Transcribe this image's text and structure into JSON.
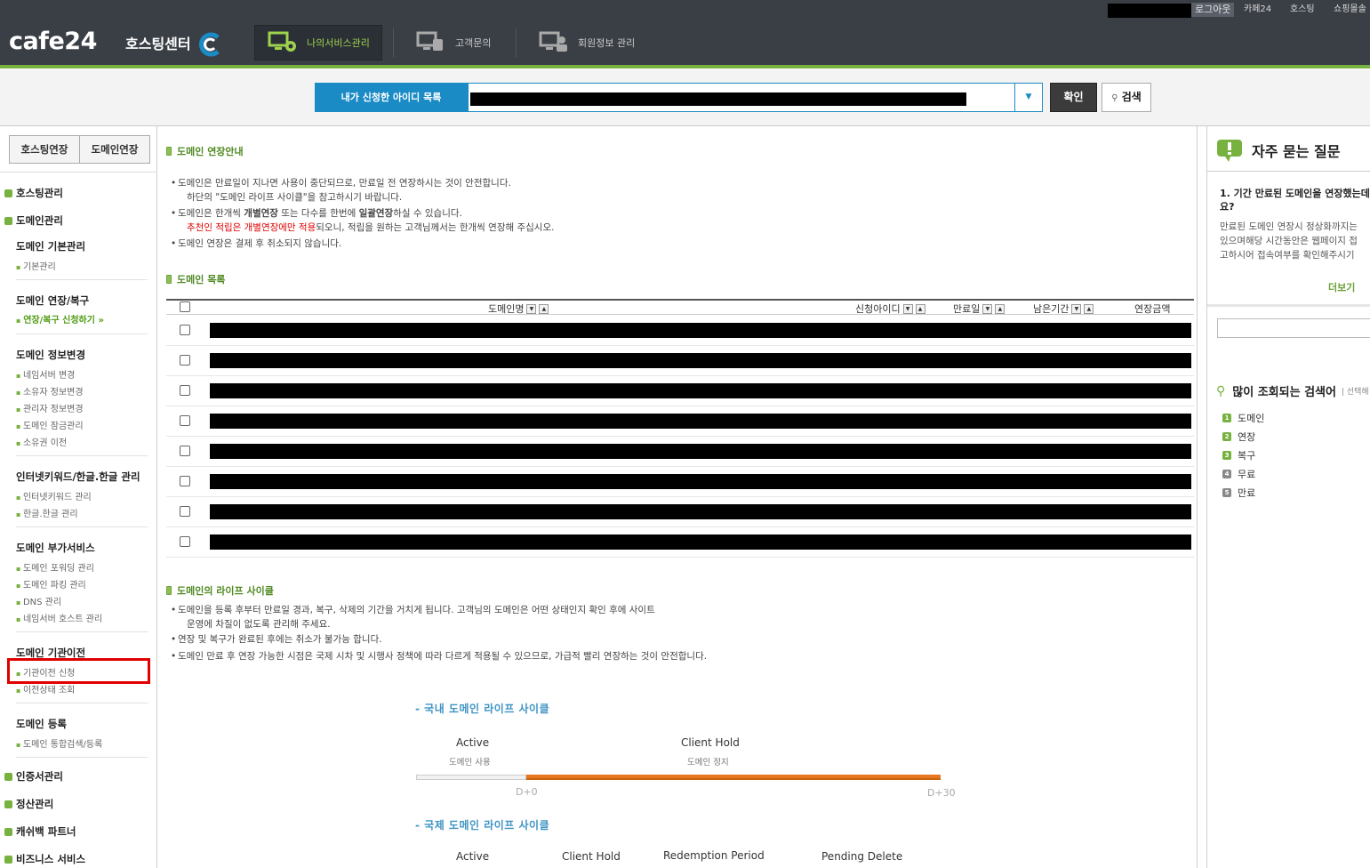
{
  "topbar": {
    "logout": "로그아웃",
    "links": [
      "카페24",
      "호스팅",
      "쇼핑몰솔"
    ]
  },
  "header": {
    "logo": "cafe24",
    "logo_sub": "호스팅센터",
    "nav": [
      {
        "label": "나의서비스관리",
        "active": true
      },
      {
        "label": "고객문의",
        "active": false
      },
      {
        "label": "회원정보 관리",
        "active": false
      }
    ]
  },
  "search": {
    "id_label": "내가 신청한 아이디 목록",
    "ok": "확인",
    "search": "검색"
  },
  "sidebar": {
    "tab_hosting": "호스팅연장",
    "tab_domain": "도메인연장",
    "cat_hosting": "호스팅관리",
    "cat_domain": "도메인관리",
    "groups": [
      {
        "title": "도메인 기본관리",
        "items": [
          "기본관리"
        ]
      },
      {
        "title": "도메인 연장/복구",
        "items": [
          "연장/복구 신청하기"
        ]
      },
      {
        "title": "도메인 정보변경",
        "items": [
          "네임서버 변경",
          "소유자 정보변경",
          "관리자 정보변경",
          "도메인 잠금관리",
          "소유권 이전"
        ]
      },
      {
        "title": "인터넷키워드/한글.한글 관리",
        "items": [
          "인터넷키워드 관리",
          "한글.한글 관리"
        ]
      },
      {
        "title": "도메인 부가서비스",
        "items": [
          "도메인 포워딩 관리",
          "도메인 파킹 관리",
          "DNS 관리",
          "네임서버 호스트 관리"
        ]
      },
      {
        "title": "도메인 기관이전",
        "items": [
          "기관이전 신청",
          "이전상태 조회"
        ]
      },
      {
        "title": "도메인 등록",
        "items": [
          "도메인 통합검색/등록"
        ]
      }
    ],
    "cats_bottom": [
      "인증서관리",
      "정산관리",
      "캐쉬백 파트너",
      "비즈니스 서비스"
    ]
  },
  "main": {
    "guide_title": "도메인 연장안내",
    "guide": {
      "l1": "도메인은 만료일이 지나면 사용이 중단되므로, 만료일 전 연장하시는 것이 안전합니다.",
      "l1b": "하단의 \"도메인 라이프 사이클\"을 참고하시기 바랍니다.",
      "l2a": "도메인은 한개씩 ",
      "l2b": "개별연장",
      "l2c": " 또는 다수를 한번에 ",
      "l2d": "일괄연장",
      "l2e": "하실 수 있습니다.",
      "l3a": "추천인 적립은 개별연장에만 적용",
      "l3b": "되오니, 적립을 원하는 고객님께서는 한개씩 연장해 주십시오.",
      "l4": "도메인 연장은 결제 후 취소되지 않습니다."
    },
    "list_title": "도메인 목록",
    "columns": [
      "도메인명",
      "신청아이디",
      "만료일",
      "남은기간",
      "연장금액"
    ],
    "row_count": 8,
    "life_title": "도메인의 라이프 사이클",
    "life": [
      "도메인을 등록 후부터 만료일 경과, 복구, 삭제의 기간을 거치게 됩니다. 고객님의 도메인은 어떤 상태인지 확인 후에 사이트",
      "운영에 차질이 없도록 관리해 주세요.",
      "연장 및 복구가 완료된 후에는 취소가 불가능 합니다.",
      "도메인 만료 후 연장 가능한 시점은 국제 시차 및 시행사 정책에 따라 다르게 적용될 수 있으므로, 가급적 빨리 연장하는 것이 안전합니다."
    ],
    "domestic": {
      "title": "- 국내 도메인 라이프 사이클",
      "active": "Active",
      "active_sub": "도메인 사용",
      "hold": "Client Hold",
      "hold_sub": "도메인 정지",
      "d0": "D+0",
      "d30": "D+30"
    },
    "intl": {
      "title": "- 국제 도메인 라이프 사이클",
      "stages": [
        "Active",
        "Client Hold",
        "Redemption Period",
        "Pending Delete"
      ]
    }
  },
  "right": {
    "faq_title": "자주 묻는 질문",
    "q1": "1. 기간 만료된 도메인을 연장했는데",
    "q1b": "요?",
    "a1": "만료된 도메인 연장시 정상화까지는",
    "a2": "있으며해당 시간동안은 웹페이지 접",
    "a3": "고하시어 접속여부를 확인해주시기 ",
    "more": "더보기",
    "popular_title": "많이 조회되는 검색어",
    "popular_sub": "| 선택해",
    "keywords": [
      "도메인",
      "연장",
      "복구",
      "무료",
      "만료"
    ]
  },
  "colors": {
    "accent_green": "#77b13f",
    "accent_blue": "#1a8bc5",
    "header_dark": "#3a3f46",
    "orange": "#e87722",
    "red": "#e00000"
  }
}
